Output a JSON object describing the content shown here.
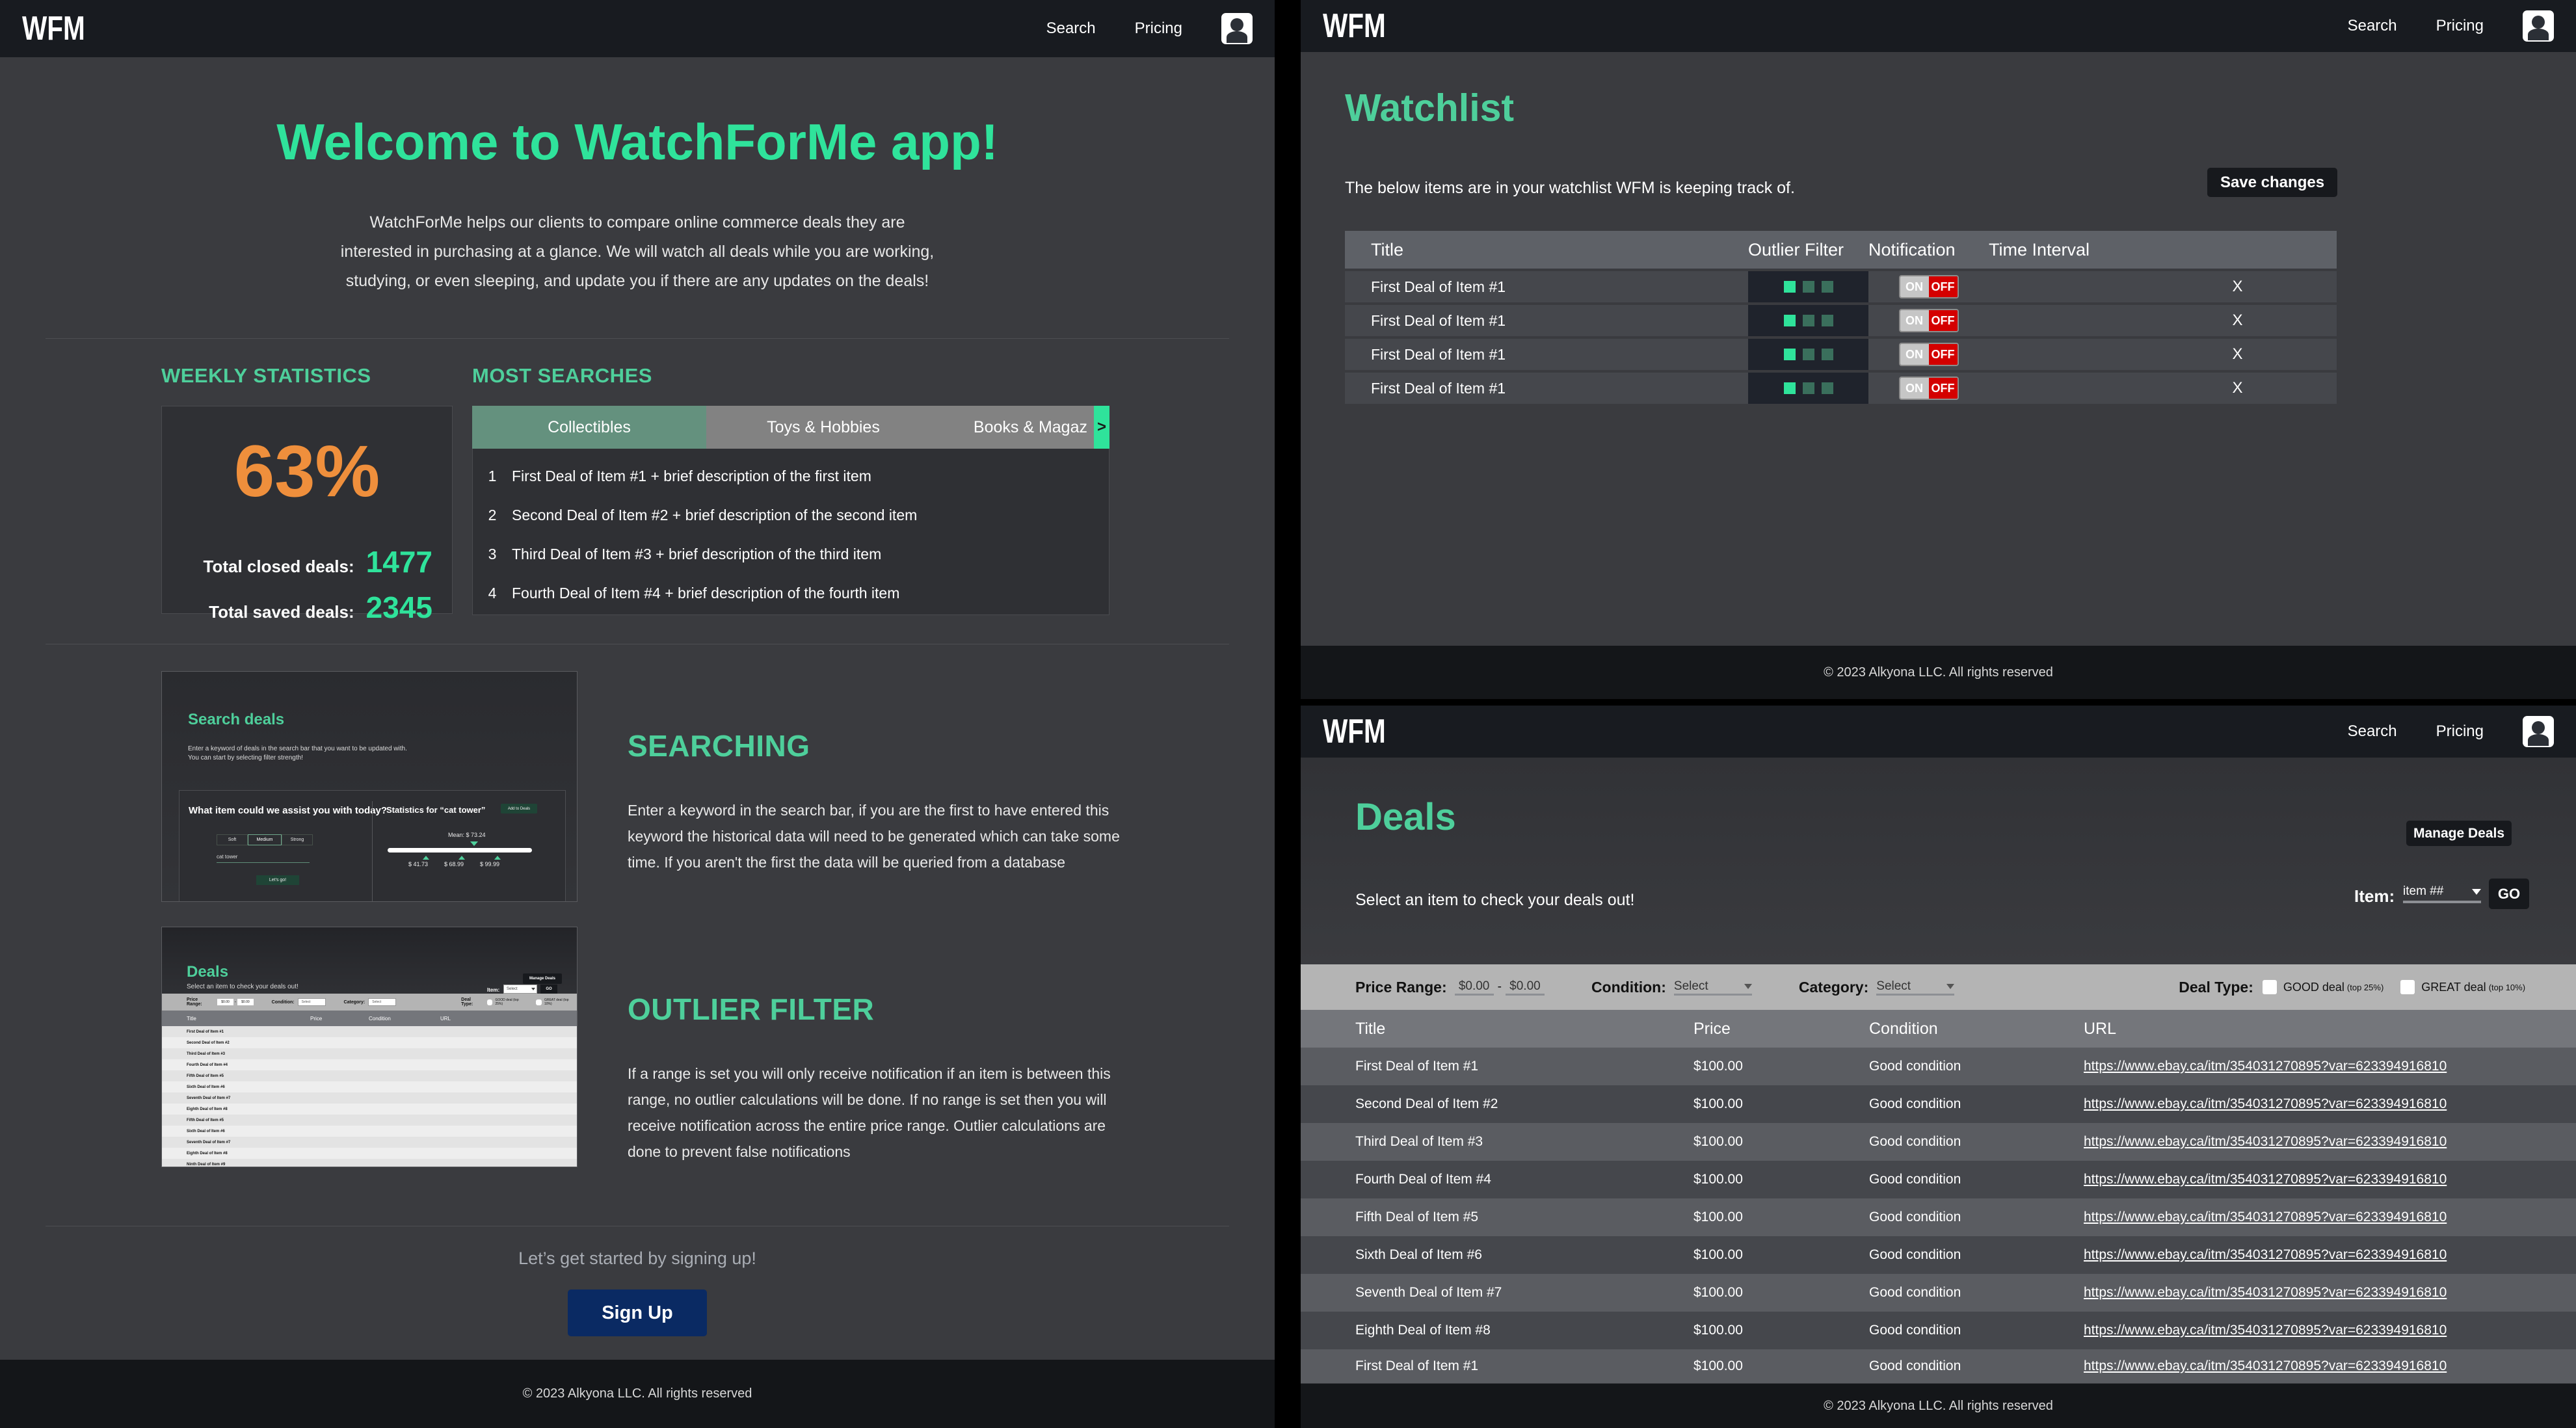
{
  "brand": {
    "logo": "WFM"
  },
  "nav": {
    "search_label": "Search",
    "pricing_label": "Pricing",
    "avatar_name": "account-avatar"
  },
  "footer": {
    "text": "© 2023 Alkyona LLC. All rights reserved"
  },
  "home": {
    "hero_title": "Welcome to WatchForMe app!",
    "hero_line1": "WatchForMe helps our clients to compare online commerce deals they are",
    "hero_line2": "interested in purchasing at a glance. We will watch all deals while you are working,",
    "hero_line3": "studying, or even sleeping, and update you if there are any updates on the deals!",
    "weekly_stats_heading": "WEEKLY STATISTICS",
    "most_searches_heading": "MOST SEARCHES",
    "percent": "63%",
    "closed_label": "Total closed deals:",
    "closed_value": "1477",
    "saved_label": "Total saved deals:",
    "saved_value": "2345",
    "tabs": [
      {
        "label": "Collectibles",
        "active": true
      },
      {
        "label": "Toys & Hobbies",
        "active": false
      },
      {
        "label": "Books & Magaz",
        "active": false
      }
    ],
    "tab_next_icon": ">",
    "search_rows": [
      {
        "num": "1",
        "text": "First Deal of Item #1 + brief description of the first item"
      },
      {
        "num": "2",
        "text": "Second Deal of Item #2 + brief description of the second item"
      },
      {
        "num": "3",
        "text": "Third Deal of Item #3 + brief description of the third item"
      },
      {
        "num": "4",
        "text": "Fourth Deal of Item #4 + brief description of the fourth item"
      }
    ],
    "features": [
      {
        "heading": "SEARCHING",
        "body": "Enter a keyword in the search bar, if you are the first to have entered this keyword the historical data will need to be generated which can take some time. If you aren't the first the data will be queried from a database"
      },
      {
        "heading": "OUTLIER FILTER",
        "body": "If a range is set you will only receive notification if an item is between this range, no outlier calculations will be done. If no range is set then you will receive notification across the entire price range. Outlier calculations are done to prevent false notifications"
      }
    ],
    "cta_text": "Let’s get started by signing up!",
    "cta_button": "Sign Up"
  },
  "shot_search": {
    "title": "Search deals",
    "line1": "Enter a keyword of deals in the search bar that you want to be updated with.",
    "line2": "You can start by selecting filter strength!",
    "question": "What item could we assist you with today?",
    "strength": [
      "Soft",
      "Medium",
      "Strong"
    ],
    "strength_selected": "Medium",
    "keyword_value": "cat tower",
    "go_button": "Let's go!",
    "stats_title": "Statistics for “cat tower”",
    "add_button": "Add to Deals",
    "mean_label": "Mean: $ 73.24",
    "ticks": [
      "$ 41.73",
      "$ 68.99",
      "$ 99.99"
    ]
  },
  "shot_deals": {
    "title": "Deals",
    "subtitle": "Select an item to check your deals out!",
    "manage_button": "Manage Deals",
    "item_label": "Item:",
    "item_value": "Select",
    "go_button": "GO",
    "price_range_label": "Price Range:",
    "price_min": "$0.00",
    "price_dash": "-",
    "price_max": "$0.00",
    "condition_label": "Condition:",
    "condition_value": "Select",
    "category_label": "Category:",
    "category_value": "Select",
    "deal_type_label": "Deal Type:",
    "good_deal": "GOOD deal (top 25%)",
    "great_deal": "GREAT deal (top 10%)",
    "columns": [
      "Title",
      "Price",
      "Condition",
      "URL"
    ],
    "rows": [
      "First Deal of Item #1",
      "Second Deal of Item #2",
      "Third Deal of Item #3",
      "Fourth Deal of Item #4",
      "Fifth Deal of Item #5",
      "Sixth Deal of Item #6",
      "Seventh Deal of Item #7",
      "Eighth Deal of Item #8",
      "Fifth Deal of Item #5",
      "Sixth Deal of Item #6",
      "Seventh Deal of Item #7",
      "Eighth Deal of Item #8",
      "Ninth Deal of Item #9"
    ]
  },
  "watchlist": {
    "title": "Watchlist",
    "subtitle": "The below items are in your watchlist WFM is keeping track of.",
    "save_button": "Save changes",
    "columns": [
      "Title",
      "Outlier Filter",
      "Notification",
      "Time Interval"
    ],
    "toggle_on": "ON",
    "toggle_off": "OFF",
    "remove_icon": "X",
    "rows": [
      {
        "title": "First Deal of Item #1"
      },
      {
        "title": "First Deal of Item #1"
      },
      {
        "title": "First Deal of Item #1"
      },
      {
        "title": "First Deal of Item #1"
      }
    ]
  },
  "deals": {
    "title": "Deals",
    "subtitle": "Select an item to check your deals out!",
    "manage_button": "Manage Deals",
    "item_label": "Item:",
    "item_value": "item ##",
    "go_button": "GO",
    "price_range_label": "Price Range:",
    "price_min": "$0.00",
    "price_dash": "-",
    "price_max": "$0.00",
    "condition_label": "Condition:",
    "condition_value": "Select",
    "category_label": "Category:",
    "category_value": "Select",
    "deal_type_label": "Deal Type:",
    "good_deal": "GOOD deal",
    "good_deal_note": "(top 25%)",
    "great_deal": "GREAT deal",
    "great_deal_note": "(top 10%)",
    "columns": [
      "Title",
      "Price",
      "Condition",
      "URL"
    ],
    "rows": [
      {
        "title": "First Deal of Item #1",
        "price": "$100.00",
        "condition": "Good condition",
        "url": "https://www.ebay.ca/itm/354031270895?var=623394916810"
      },
      {
        "title": "Second Deal of Item #2",
        "price": "$100.00",
        "condition": "Good condition",
        "url": "https://www.ebay.ca/itm/354031270895?var=623394916810"
      },
      {
        "title": "Third Deal of Item #3",
        "price": "$100.00",
        "condition": "Good condition",
        "url": "https://www.ebay.ca/itm/354031270895?var=623394916810"
      },
      {
        "title": "Fourth Deal of Item #4",
        "price": "$100.00",
        "condition": "Good condition",
        "url": "https://www.ebay.ca/itm/354031270895?var=623394916810"
      },
      {
        "title": "Fifth Deal of Item #5",
        "price": "$100.00",
        "condition": "Good condition",
        "url": "https://www.ebay.ca/itm/354031270895?var=623394916810"
      },
      {
        "title": "Sixth Deal of Item #6",
        "price": "$100.00",
        "condition": "Good condition",
        "url": "https://www.ebay.ca/itm/354031270895?var=623394916810"
      },
      {
        "title": "Seventh Deal of Item #7",
        "price": "$100.00",
        "condition": "Good condition",
        "url": "https://www.ebay.ca/itm/354031270895?var=623394916810"
      },
      {
        "title": "Eighth Deal of Item #8",
        "price": "$100.00",
        "condition": "Good condition",
        "url": "https://www.ebay.ca/itm/354031270895?var=623394916810"
      },
      {
        "title": "First Deal of Item #1",
        "price": "$100.00",
        "condition": "Good condition",
        "url": "https://www.ebay.ca/itm/354031270895?var=623394916810"
      }
    ]
  },
  "colors": {
    "accent_green": "#2fe39b",
    "accent_green_soft": "#4ecf9b",
    "orange": "#ef8f3c",
    "nav_bg": "#181b20",
    "panel_bg": "#3a3b3f",
    "signup_blue": "#0a2a63",
    "toggle_off_red": "#d40000"
  }
}
